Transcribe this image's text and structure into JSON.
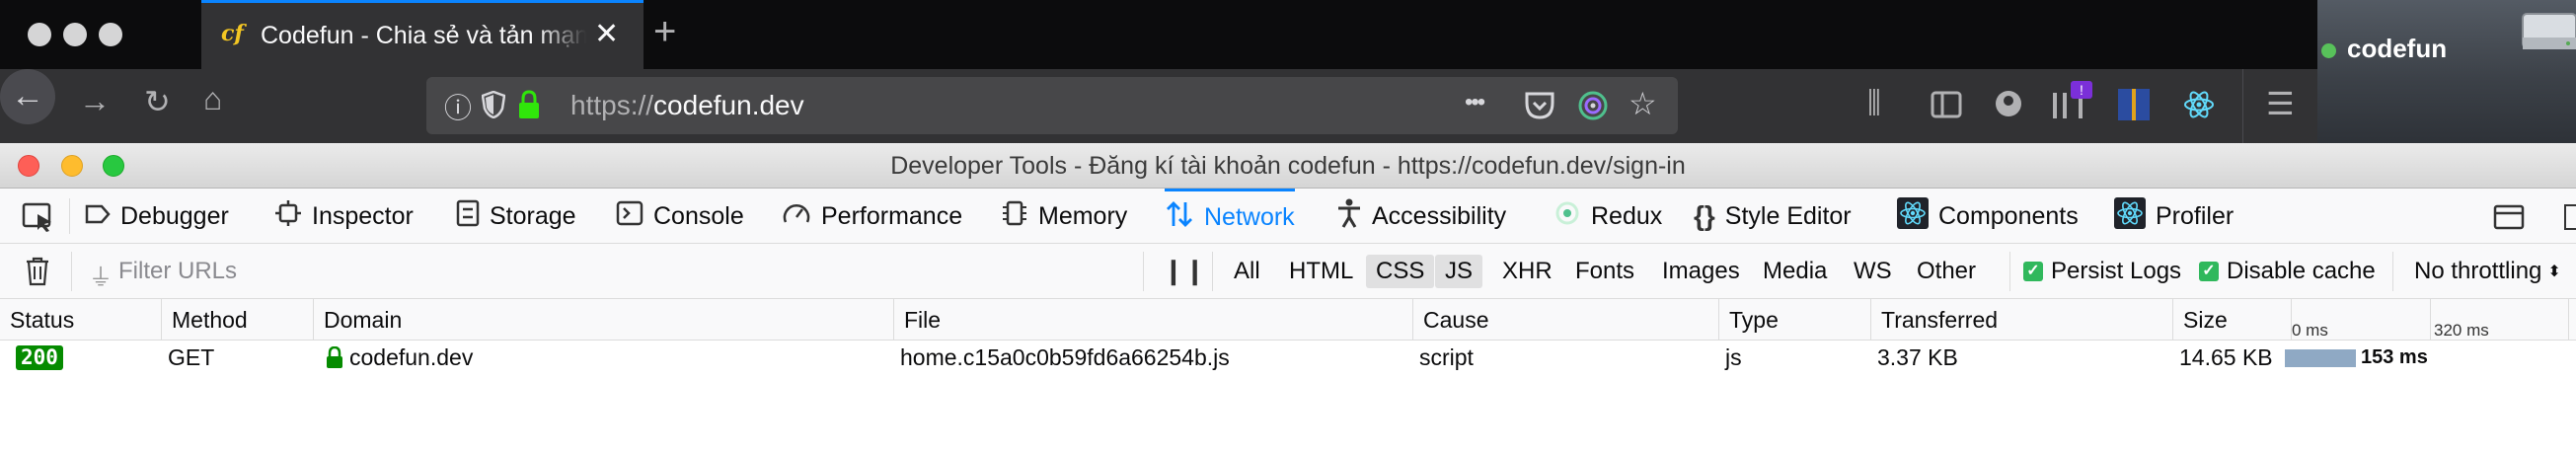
{
  "browser": {
    "tab": {
      "favicon_text": "cf",
      "title": "Codefun - Chia sẻ và tản mạn n",
      "close_glyph": "✕"
    },
    "new_tab_glyph": "+",
    "url": {
      "scheme": "https://",
      "host": "codefun.dev"
    },
    "page_actions_glyph": "•••"
  },
  "desktop": {
    "user_label": "codefun"
  },
  "devtools": {
    "window_title": "Developer Tools - Đăng kí tài khoản codefun - https://codefun.dev/sign-in",
    "tabs": [
      {
        "label": "Debugger",
        "icon": "debugger-icon"
      },
      {
        "label": "Inspector",
        "icon": "inspector-icon"
      },
      {
        "label": "Storage",
        "icon": "storage-icon"
      },
      {
        "label": "Console",
        "icon": "console-icon"
      },
      {
        "label": "Performance",
        "icon": "performance-icon"
      },
      {
        "label": "Memory",
        "icon": "memory-icon"
      },
      {
        "label": "Network",
        "icon": "network-icon"
      },
      {
        "label": "Accessibility",
        "icon": "accessibility-icon"
      },
      {
        "label": "Redux",
        "icon": "redux-icon"
      },
      {
        "label": "Style Editor",
        "icon": "style-editor-icon"
      },
      {
        "label": "Components",
        "icon": "react-icon"
      },
      {
        "label": "Profiler",
        "icon": "react-icon"
      }
    ],
    "active_tab": "Network",
    "filter": {
      "placeholder": "Filter URLs",
      "types": [
        "All",
        "HTML",
        "CSS",
        "JS",
        "XHR",
        "Fonts",
        "Images",
        "Media",
        "WS",
        "Other"
      ],
      "active_types": [
        "CSS",
        "JS"
      ],
      "persist_logs": "Persist Logs",
      "disable_cache": "Disable cache",
      "throttling": "No throttling"
    },
    "columns": [
      "Status",
      "Method",
      "Domain",
      "File",
      "Cause",
      "Type",
      "Transferred",
      "Size"
    ],
    "waterfall_ticks": [
      "0 ms",
      "320 ms"
    ],
    "requests": [
      {
        "status": "200",
        "method": "GET",
        "domain": "codefun.dev",
        "file": "home.c15a0c0b59fd6a66254b.js",
        "cause": "script",
        "type": "js",
        "transferred": "3.37 KB",
        "size": "14.65 KB",
        "timing": "153 ms"
      }
    ]
  },
  "colors": {
    "accent": "#0a84ff",
    "status_ok": "#058b00",
    "checkbox": "#30b85c"
  }
}
